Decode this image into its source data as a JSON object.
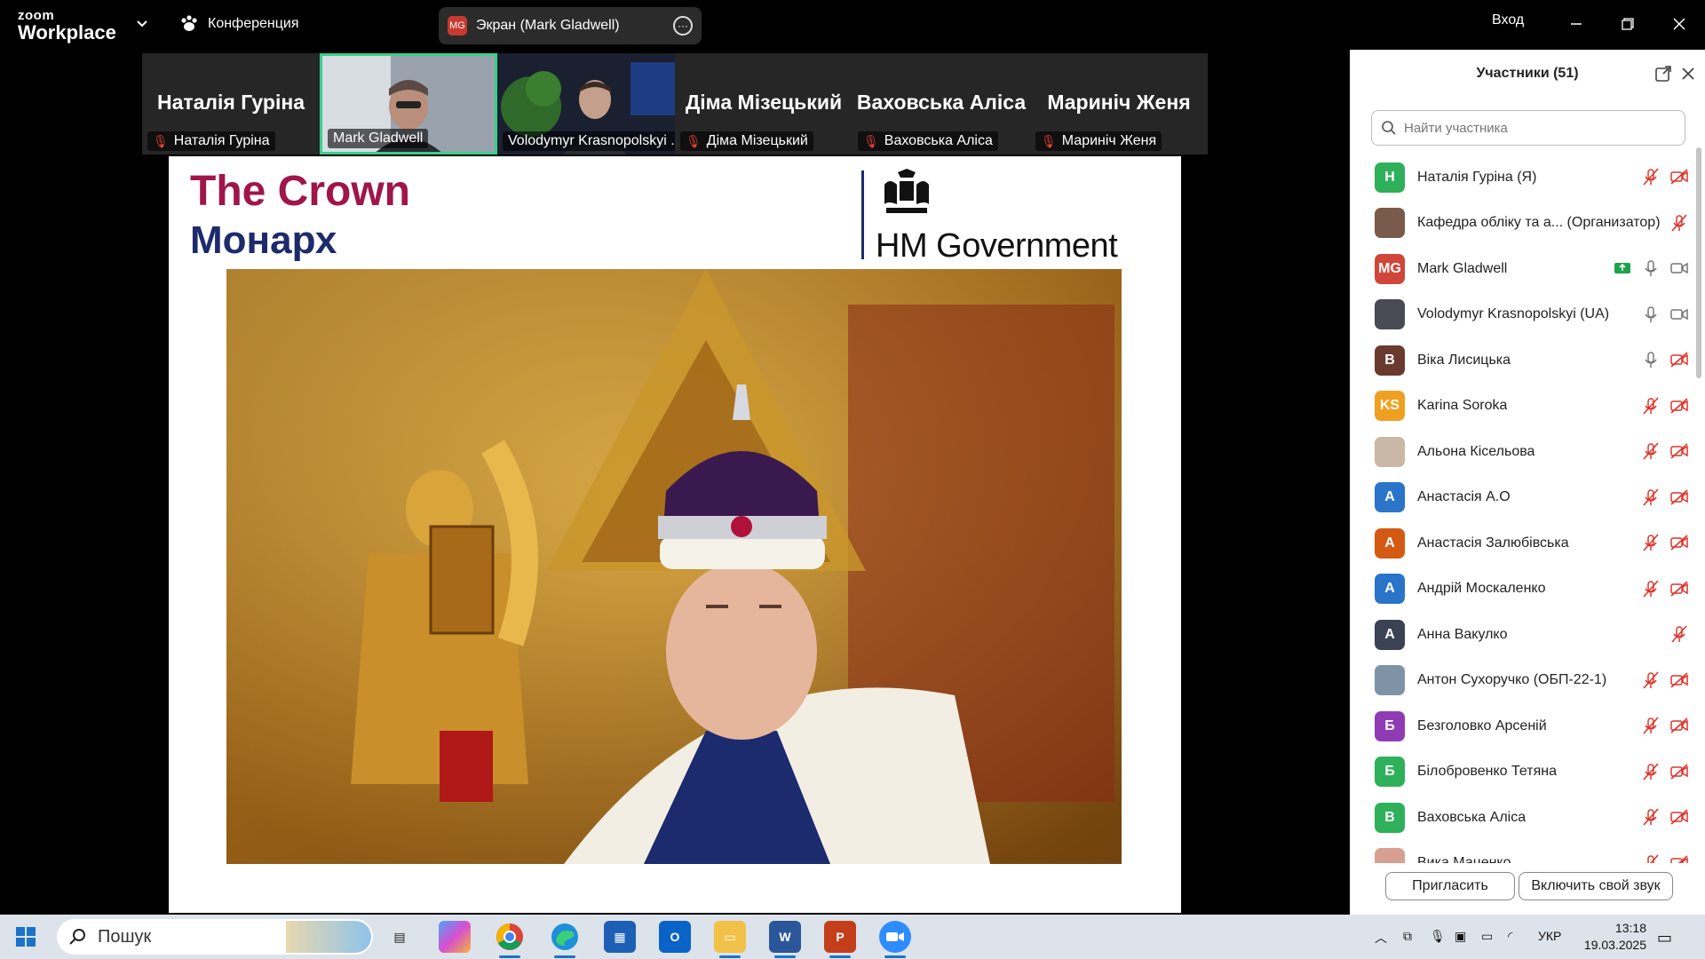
{
  "titlebar": {
    "logo_small": "zoom",
    "logo_big": "Workplace",
    "conference_label": "Конференция",
    "screen_badge": "MG",
    "screen_label": "Экран (Mark Gladwell)",
    "signin_label": "Вход"
  },
  "strip": {
    "tiles": [
      {
        "big_name": "Наталія Гуріна",
        "label": "Наталія Гуріна",
        "muted": true
      },
      {
        "big_name": "",
        "label": "Mark Gladwell",
        "muted": false
      },
      {
        "big_name": "",
        "label": "Volodymyr Krasnopolskyi ...",
        "muted": false
      },
      {
        "big_name": "Діма Мізецький",
        "label": "Діма Мізецький",
        "muted": true
      },
      {
        "big_name": "Ваховська Аліса",
        "label": "Ваховська Аліса",
        "muted": true
      },
      {
        "big_name": "Маринiч Женя",
        "label": "Маринiч Женя",
        "muted": true
      }
    ]
  },
  "slide": {
    "title_line1": "The Crown",
    "title_line2": "Монарх",
    "logo_text": "HM Government"
  },
  "panel": {
    "title": "Участники (51)",
    "search_placeholder": "Найти участника",
    "invite_label": "Пригласить",
    "unmute_label": "Включить свой звук",
    "participants": [
      {
        "initials": "Н",
        "name": "Наталія Гуріна (Я)",
        "color": "#2fb05a",
        "mic": "muted",
        "cam": "off"
      },
      {
        "initials": "",
        "name": "Кафедра обліку та а... (Организатор)",
        "color": "#7a5a4a",
        "mic": "muted",
        "cam": "none"
      },
      {
        "initials": "MG",
        "name": "Mark Gladwell",
        "color": "#d1463a",
        "mic": "on",
        "cam": "on",
        "share": true
      },
      {
        "initials": "",
        "name": "Volodymyr Krasnopolskyi (UA)",
        "color": "#4a4a55",
        "mic": "on",
        "cam": "on"
      },
      {
        "initials": "В",
        "name": "Віка Лисицька",
        "color": "#6b3a2e",
        "mic": "on",
        "cam": "off"
      },
      {
        "initials": "KS",
        "name": "Karina Soroka",
        "color": "#f0a020",
        "mic": "muted",
        "cam": "off"
      },
      {
        "initials": "",
        "name": "Альона Кісельова",
        "color": "#c9b8a6",
        "mic": "muted",
        "cam": "off"
      },
      {
        "initials": "А",
        "name": "Анастасія А.О",
        "color": "#2a74c9",
        "mic": "muted",
        "cam": "off"
      },
      {
        "initials": "А",
        "name": "Анастасія Залюбівська",
        "color": "#d45a14",
        "mic": "muted",
        "cam": "off"
      },
      {
        "initials": "А",
        "name": "Андрій Москаленко",
        "color": "#2a74c9",
        "mic": "muted",
        "cam": "off"
      },
      {
        "initials": "А",
        "name": "Анна Вакулко",
        "color": "#3a4254",
        "mic": "muted",
        "cam": "none"
      },
      {
        "initials": "",
        "name": "Антон Сухоручко (ОБП-22-1)",
        "color": "#7f93a6",
        "mic": "muted",
        "cam": "off"
      },
      {
        "initials": "Б",
        "name": "Безголовко Арсеній",
        "color": "#8f3cb4",
        "mic": "muted",
        "cam": "off"
      },
      {
        "initials": "Б",
        "name": "Білобровенко Тетяна",
        "color": "#2fb05a",
        "mic": "muted",
        "cam": "off"
      },
      {
        "initials": "В",
        "name": "Ваховська Аліса",
        "color": "#2fb05a",
        "mic": "muted",
        "cam": "off"
      },
      {
        "initials": "",
        "name": "Вика Маценко",
        "color": "#d8a090",
        "mic": "muted",
        "cam": "off"
      }
    ]
  },
  "taskbar": {
    "search_label": "Пошук",
    "lang": "УКР",
    "time": "13:18",
    "date": "19.03.2025"
  }
}
